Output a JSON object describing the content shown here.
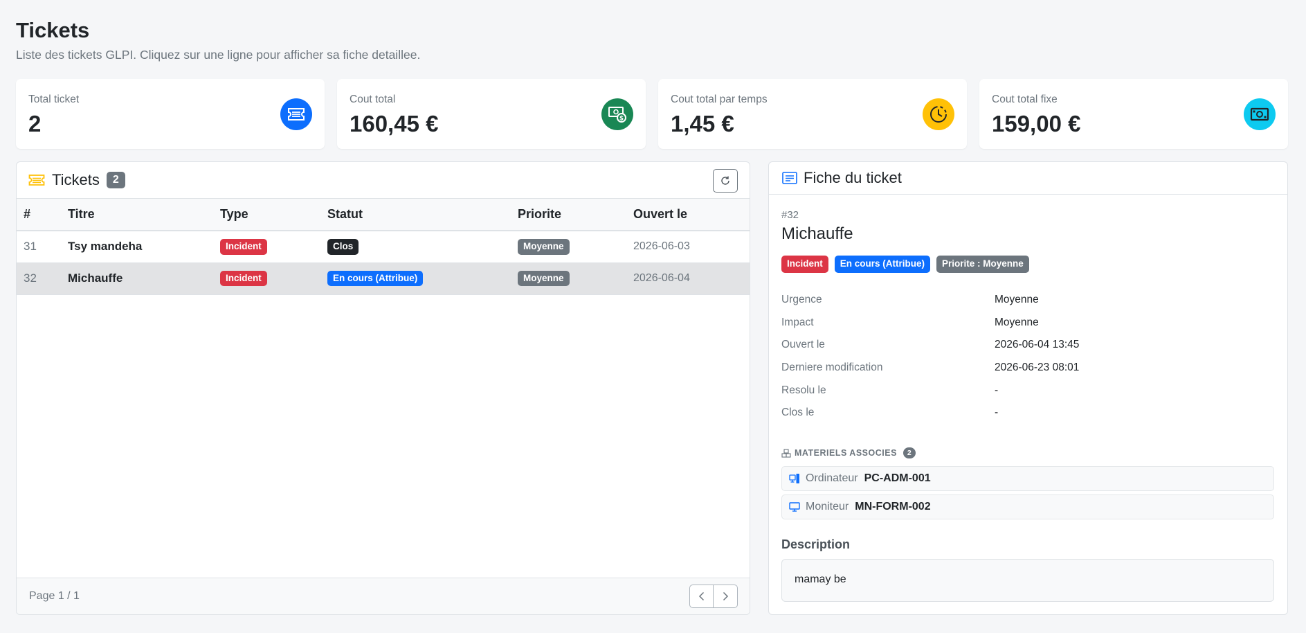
{
  "page": {
    "title": "Tickets",
    "subtitle": "Liste des tickets GLPI. Cliquez sur une ligne pour afficher sa fiche detaillee."
  },
  "stats": [
    {
      "label": "Total ticket",
      "value": "2",
      "icon": "ticket-icon",
      "color": "#0d6efd"
    },
    {
      "label": "Cout total",
      "value": "160,45 €",
      "icon": "cash-coin-icon",
      "color": "#198754"
    },
    {
      "label": "Cout total par temps",
      "value": "1,45 €",
      "icon": "clock-icon",
      "color": "#ffc107"
    },
    {
      "label": "Cout total fixe",
      "value": "159,00 €",
      "icon": "cash-icon",
      "color": "#0dcaf0"
    }
  ],
  "tickets_panel": {
    "title": "Tickets",
    "count": "2",
    "columns": [
      "#",
      "Titre",
      "Type",
      "Statut",
      "Priorite",
      "Ouvert le"
    ],
    "rows": [
      {
        "id": "31",
        "title": "Tsy mandeha",
        "type": "Incident",
        "status": "Clos",
        "priority": "Moyenne",
        "opened": "2026-06-03"
      },
      {
        "id": "32",
        "title": "Michauffe",
        "type": "Incident",
        "status": "En cours (Attribue)",
        "priority": "Moyenne",
        "opened": "2026-06-04"
      }
    ],
    "page_label": "Page 1 / 1"
  },
  "detail": {
    "header": "Fiche du ticket",
    "id": "#32",
    "title": "Michauffe",
    "badges": {
      "type": "Incident",
      "status": "En cours (Attribue)",
      "priority": "Priorite : Moyenne"
    },
    "fields": [
      {
        "label": "Urgence",
        "value": "Moyenne"
      },
      {
        "label": "Impact",
        "value": "Moyenne"
      },
      {
        "label": "Ouvert le",
        "value": "2026-06-04 13:45"
      },
      {
        "label": "Derniere modification",
        "value": "2026-06-23 08:01"
      },
      {
        "label": "Resolu le",
        "value": "-"
      },
      {
        "label": "Clos le",
        "value": "-"
      }
    ],
    "assets_title": "MATERIELS ASSOCIES",
    "assets_count": "2",
    "assets": [
      {
        "type": "Ordinateur",
        "name": "PC-ADM-001",
        "icon": "computer-icon"
      },
      {
        "type": "Moniteur",
        "name": "MN-FORM-002",
        "icon": "monitor-icon"
      }
    ],
    "description_title": "Description",
    "description": "mamay be"
  },
  "colors": {
    "danger": "#dc3545",
    "primary": "#0d6efd",
    "secondary": "#6c757d",
    "dark": "#212529",
    "warning": "#ffc107"
  }
}
